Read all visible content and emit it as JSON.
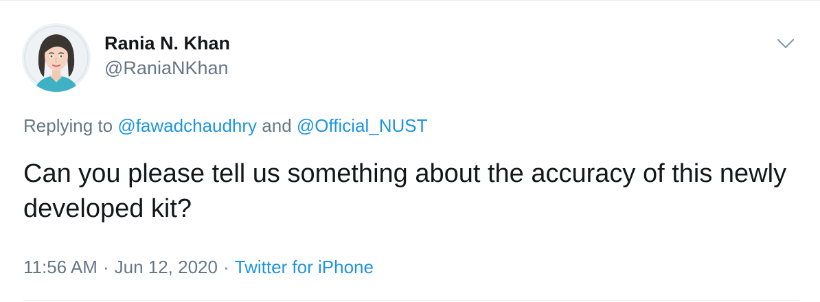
{
  "author": {
    "display_name": "Rania N. Khan",
    "handle": "@RaniaNKhan"
  },
  "reply_context": {
    "prefix": "Replying to",
    "mention_1": "@fawadchaudhry",
    "conjunction": "and",
    "mention_2": "@Official_NUST"
  },
  "tweet": {
    "text": "Can you please tell us something about the accuracy of this newly developed kit?"
  },
  "meta": {
    "time": "11:56 AM",
    "separator": "·",
    "date": "Jun 12, 2020",
    "source": "Twitter for iPhone"
  },
  "icons": {
    "menu": "chevron-down-icon",
    "avatar": "avatar-illustration"
  },
  "colors": {
    "link": "#1b95e0",
    "secondary_text": "#657786",
    "primary_text": "#14171a",
    "divider": "#e6ecf0"
  }
}
